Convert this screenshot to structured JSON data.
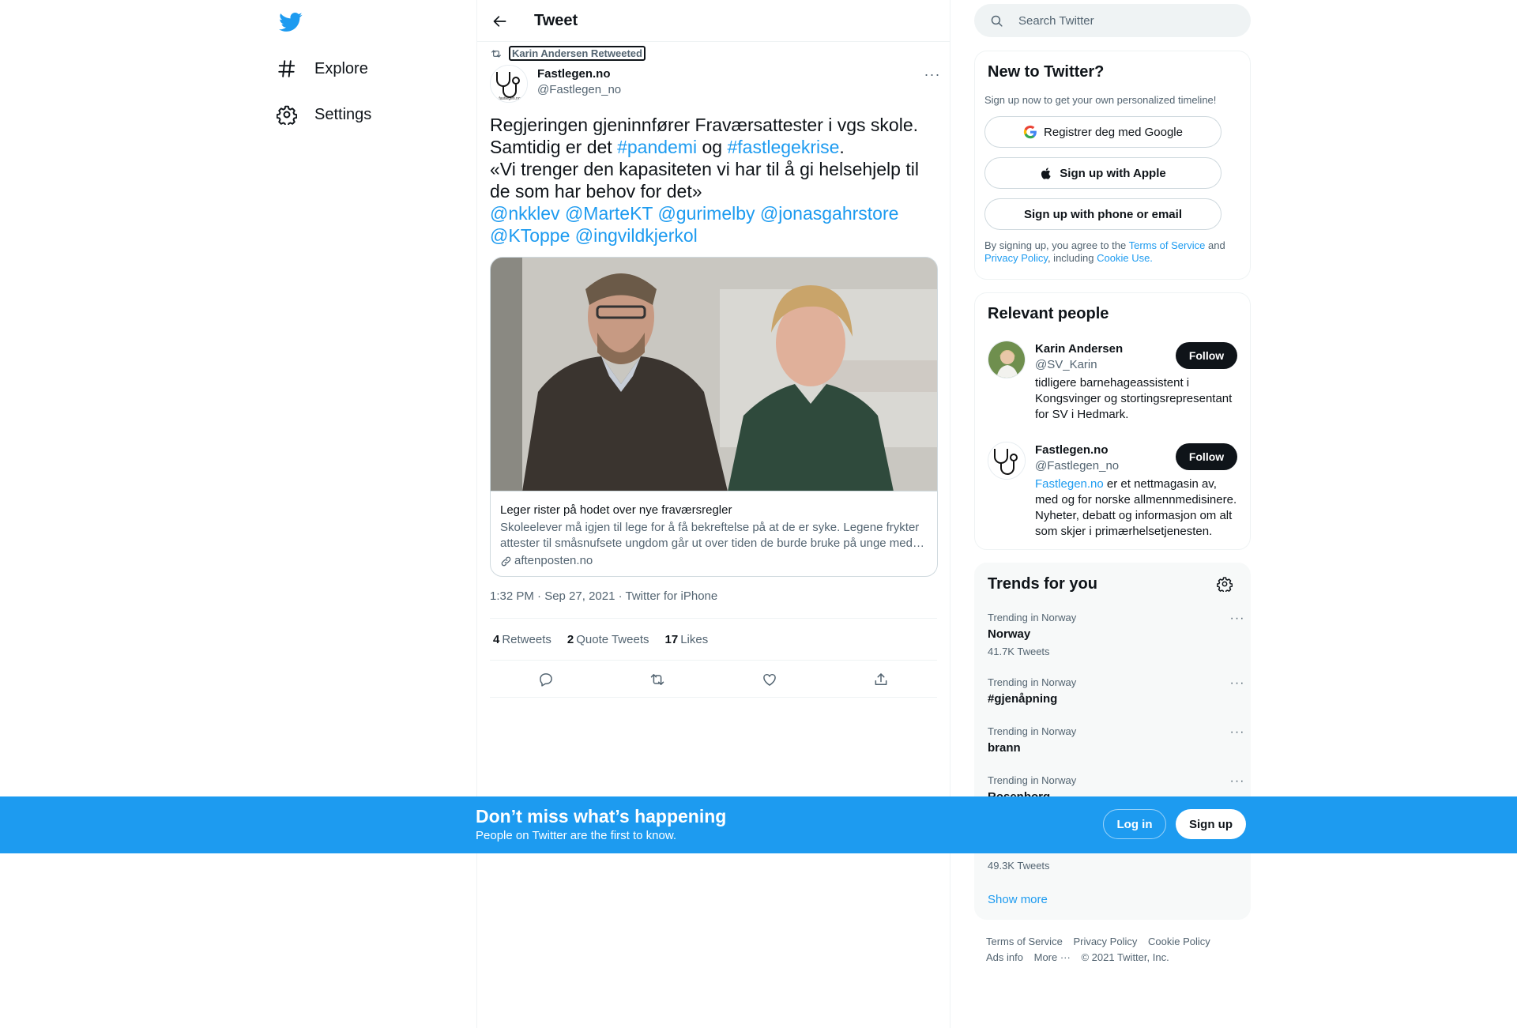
{
  "nav": {
    "logo_icon": "twitter-bird-icon",
    "items": [
      {
        "label": "Explore",
        "icon": "hashtag-icon"
      },
      {
        "label": "Settings",
        "icon": "gear-icon"
      }
    ]
  },
  "header": {
    "title": "Tweet",
    "back_icon": "arrow-left-icon"
  },
  "tweet": {
    "retweeted_by": "Karin Andersen Retweeted",
    "author_name": "Fastlegen.no",
    "author_handle": "@Fastlegen_no",
    "avatar_caption": "fastlegen.no",
    "text": {
      "line1": "Regjeringen gjeninnfører Fraværsattester i vgs skole.",
      "line2_pre": "Samtidig er det ",
      "hashtag1": "#pandemi",
      "line2_mid": " og ",
      "hashtag2": "#fastlegekrise",
      "line2_end": ".",
      "line3": "«Vi trenger den kapasiteten vi har til å gi helsehjelp til de som har behov for det»",
      "mention1": "@nkklev",
      "mention2": "@MarteKT",
      "mention3": "@gurimelby",
      "mention4": "@jonasgahrstore",
      "mention5": "@KToppe",
      "mention6": "@ingvildkjerkol"
    },
    "card": {
      "title": "Leger rister på hodet over nye fraværsregler",
      "description": "Skoleelever må igjen til lege for å få bekreftelse på at de er syke. Legene frykter attester til småsnufsete ungdom går ut over tiden de burde bruke på unge med…",
      "domain": "aftenposten.no"
    },
    "meta": "1:32 PM · Sep 27, 2021 · Twitter for iPhone",
    "stats": {
      "retweets_count": "4",
      "retweets_label": "Retweets",
      "quotes_count": "2",
      "quotes_label": "Quote Tweets",
      "likes_count": "17",
      "likes_label": "Likes"
    },
    "actions": [
      "reply-icon",
      "retweet-icon",
      "like-icon",
      "share-icon"
    ]
  },
  "search": {
    "placeholder": "Search Twitter"
  },
  "signup_panel": {
    "title": "New to Twitter?",
    "subtitle": "Sign up now to get your own personalized timeline!",
    "google_label": "Registrer deg med Google",
    "apple_label": "Sign up with Apple",
    "phone_label": "Sign up with phone or email",
    "legal_pre": "By signing up, you agree to the ",
    "legal_tos": "Terms of Service",
    "legal_and": " and ",
    "legal_privacy": "Privacy Policy",
    "legal_including": ", including ",
    "legal_cookie": "Cookie Use."
  },
  "relevant_people": {
    "title": "Relevant people",
    "people": [
      {
        "name": "Karin Andersen",
        "handle": "@SV_Karin",
        "bio": "tidligere barnehageassistent i Kongsvinger og stortingsrepresentant for SV i Hedmark.",
        "follow_label": "Follow"
      },
      {
        "name": "Fastlegen.no",
        "handle": "@Fastlegen_no",
        "bio_link": "Fastlegen.no",
        "bio": " er et nettmagasin av, med og for norske allmennmedisinere. Nyheter, debatt og informasjon om alt som skjer i primærhelsetjenesten.",
        "follow_label": "Follow"
      }
    ]
  },
  "trends": {
    "title": "Trends for you",
    "items": [
      {
        "context": "Trending in Norway",
        "name": "Norway",
        "count": "41.7K Tweets"
      },
      {
        "context": "Trending in Norway",
        "name": "#gjenåpning",
        "count": ""
      },
      {
        "context": "Trending in Norway",
        "name": "brann",
        "count": ""
      },
      {
        "context": "Trending in Norway",
        "name": "Rosenborg",
        "count": ""
      }
    ],
    "hidden_count": "49.3K Tweets",
    "show_more": "Show more"
  },
  "footer": {
    "tos": "Terms of Service",
    "privacy": "Privacy Policy",
    "cookie": "Cookie Policy",
    "ads": "Ads info",
    "more": "More ···",
    "copyright": "© 2021 Twitter, Inc."
  },
  "banner": {
    "title": "Don’t miss what’s happening",
    "subtitle": "People on Twitter are the first to know.",
    "login_label": "Log in",
    "signup_label": "Sign up"
  },
  "colors": {
    "accent": "#1d9bf0",
    "text": "#0f1419",
    "muted": "#536471"
  }
}
